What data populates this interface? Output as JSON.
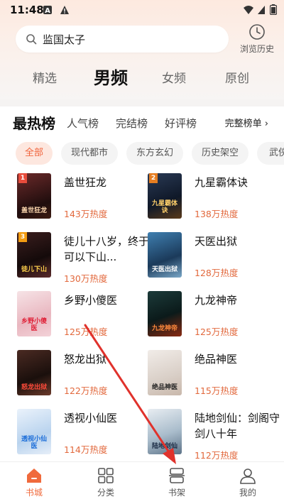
{
  "status_bar": {
    "time": "11:48"
  },
  "search": {
    "value": "监国太子",
    "history_label": "浏览历史"
  },
  "channels": [
    {
      "label": "精选",
      "active": false
    },
    {
      "label": "男频",
      "active": true
    },
    {
      "label": "女频",
      "active": false
    },
    {
      "label": "原创",
      "active": false
    }
  ],
  "ranks": {
    "active": "最热榜",
    "tabs": [
      "人气榜",
      "完结榜",
      "好评榜"
    ],
    "full_label": "完整榜单 ›"
  },
  "chips": [
    "全部",
    "现代都市",
    "东方玄幻",
    "历史架空",
    "武侠"
  ],
  "books": [
    {
      "title": "盖世狂龙",
      "heat": "143万热度",
      "rank": "1",
      "cover_text": "盖世狂龙"
    },
    {
      "title": "九星霸体诀",
      "heat": "138万热度",
      "rank": "2",
      "cover_text": "九星霸体诀"
    },
    {
      "title": "徒儿十八岁，终于可以下山...",
      "heat": "130万热度",
      "rank": "3",
      "cover_text": "徒儿下山"
    },
    {
      "title": "天医出狱",
      "heat": "128万热度",
      "rank": "",
      "cover_text": "天医出狱"
    },
    {
      "title": "乡野小傻医",
      "heat": "125万热度",
      "rank": "",
      "cover_text": "乡野小傻医"
    },
    {
      "title": "九龙神帝",
      "heat": "125万热度",
      "rank": "",
      "cover_text": "九龙神帝"
    },
    {
      "title": "怒龙出狱",
      "heat": "122万热度",
      "rank": "",
      "cover_text": "怒龙出狱"
    },
    {
      "title": "绝品神医",
      "heat": "115万热度",
      "rank": "",
      "cover_text": "绝品神医"
    },
    {
      "title": "透视小仙医",
      "heat": "114万热度",
      "rank": "",
      "cover_text": "透视小仙医"
    },
    {
      "title": "陆地剑仙：剑阁守剑八十年",
      "heat": "112万热度",
      "rank": "",
      "cover_text": "陆地剑仙"
    }
  ],
  "nav": [
    {
      "label": "书城",
      "icon": "home-icon",
      "active": true
    },
    {
      "label": "分类",
      "icon": "grid-icon",
      "active": false
    },
    {
      "label": "书架",
      "icon": "bookshelf-icon",
      "active": false
    },
    {
      "label": "我的",
      "icon": "user-icon",
      "active": false
    }
  ],
  "colors": {
    "accent": "#f06a3c",
    "heat": "#e2683c",
    "annotation_arrow": "#e0322c"
  }
}
